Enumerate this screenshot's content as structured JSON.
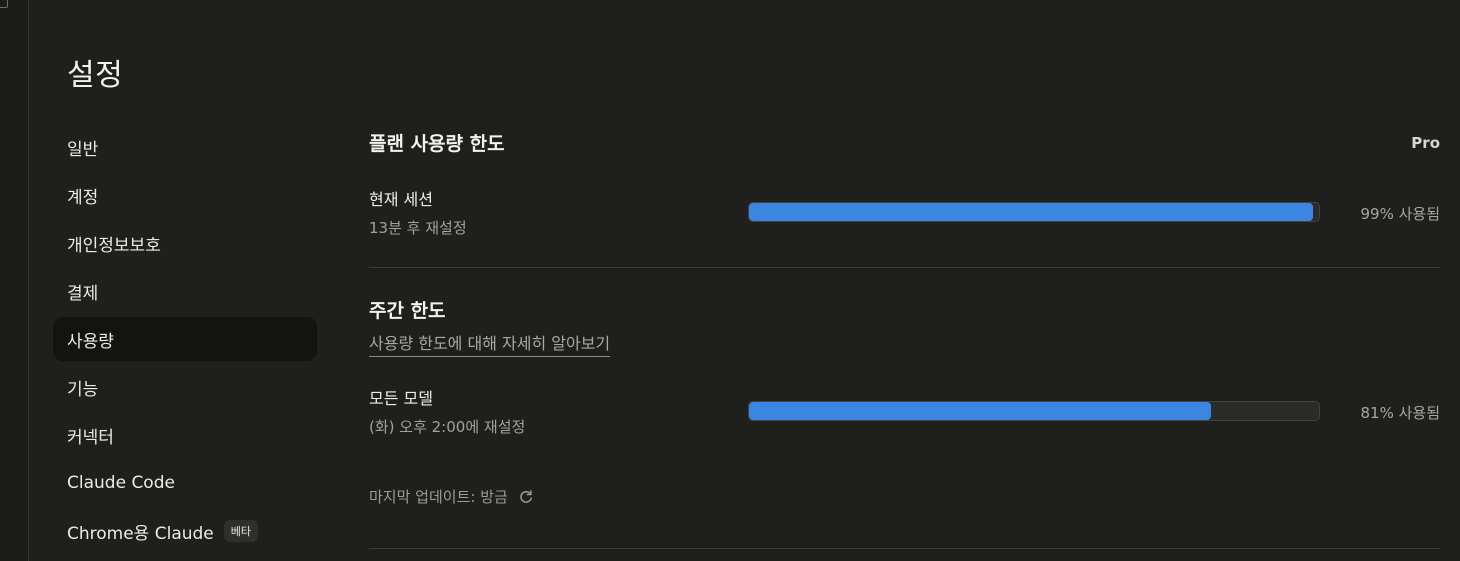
{
  "page": {
    "title": "설정"
  },
  "nav": {
    "items": [
      {
        "label": "일반"
      },
      {
        "label": "계정"
      },
      {
        "label": "개인정보보호"
      },
      {
        "label": "결제"
      },
      {
        "label": "사용량"
      },
      {
        "label": "기능"
      },
      {
        "label": "커넥터"
      },
      {
        "label": "Claude Code"
      },
      {
        "label": "Chrome용 Claude",
        "badge": "베타"
      }
    ],
    "active_index": 4
  },
  "plan_limits": {
    "title": "플랜 사용량 한도",
    "plan": "Pro",
    "current_session": {
      "label": "현재 세션",
      "reset": "13분 후 재설정",
      "percent": 99,
      "percent_text": "99% 사용됨"
    }
  },
  "weekly_limits": {
    "title": "주간 한도",
    "learn_more": "사용량 한도에 대해 자세히 알아보기",
    "all_models": {
      "label": "모든 모델",
      "reset": "(화) 오후 2:00에 재설정",
      "percent": 81,
      "percent_text": "81% 사용됨"
    }
  },
  "last_updated": "마지막 업데이트: 방금",
  "colors": {
    "background": "#1f1f1e",
    "accent_bar": "#3b86e3",
    "active_nav": "#131312"
  },
  "icons": {
    "refresh": "refresh-icon"
  }
}
